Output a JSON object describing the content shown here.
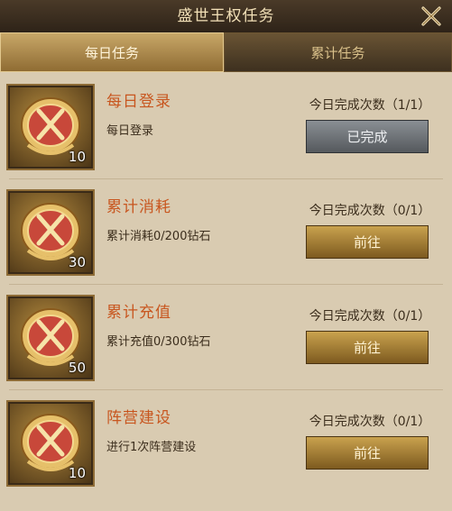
{
  "window": {
    "title": "盛世王权任务"
  },
  "tabs": [
    {
      "label": "每日任务"
    },
    {
      "label": "累计任务"
    }
  ],
  "tasks": [
    {
      "name": "每日登录",
      "desc": "每日登录",
      "reward_count": "10",
      "progress": "今日完成次数（1/1）",
      "button": "已完成",
      "state": "done"
    },
    {
      "name": "累计消耗",
      "desc": "累计消耗0/200钻石",
      "reward_count": "30",
      "progress": "今日完成次数（0/1）",
      "button": "前往",
      "state": "go"
    },
    {
      "name": "累计充值",
      "desc": "累计充值0/300钻石",
      "reward_count": "50",
      "progress": "今日完成次数（0/1）",
      "button": "前往",
      "state": "go"
    },
    {
      "name": "阵营建设",
      "desc": "进行1次阵营建设",
      "reward_count": "10",
      "progress": "今日完成次数（0/1）",
      "button": "前往",
      "state": "go"
    }
  ],
  "colors": {
    "accent": "#c8561f",
    "panel": "#d9cbb1",
    "gold": "#c9a24e"
  },
  "icons": {
    "close": "close-icon",
    "reward": "crossed-swords-medal-icon"
  }
}
